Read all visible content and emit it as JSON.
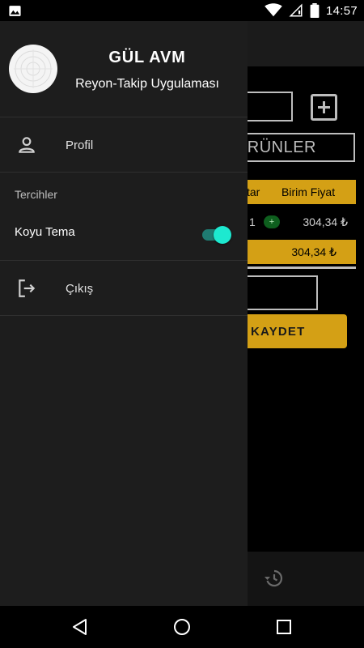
{
  "status_bar": {
    "time": "14:57",
    "icons": [
      "image-icon",
      "wifi-icon",
      "no-sim-icon",
      "battery-icon"
    ]
  },
  "drawer": {
    "header": {
      "title": "GÜL AVM",
      "subtitle": "Reyon-Takip Uygulaması"
    },
    "menu": {
      "profile_label": "Profil",
      "preferences_title": "Tercihler",
      "dark_theme_label": "Koyu Tema",
      "dark_theme_enabled": true,
      "logout_label": "Çıkış"
    }
  },
  "background_app": {
    "search_label": "ÜRÜNLER",
    "table_headers": [
      "ktar",
      "Birim Fiyat"
    ],
    "row": {
      "quantity": "1",
      "increment": "+",
      "unit_price": "304,34 ₺"
    },
    "total": "304,34 ₺",
    "save_button": "KAYDET"
  },
  "colors": {
    "drawer_bg": "#1d1d1d",
    "accent_gold": "#d4a015",
    "toggle_on": "#1de9d0"
  },
  "nav_bar": {
    "icons": [
      "back-icon",
      "home-icon",
      "recents-icon"
    ]
  }
}
